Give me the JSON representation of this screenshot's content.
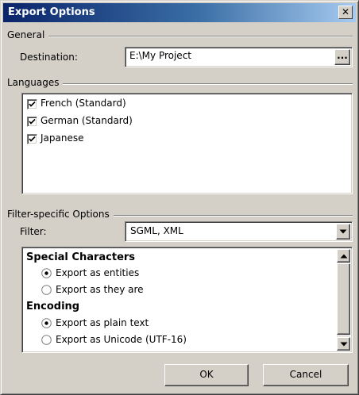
{
  "window": {
    "title": "Export Options",
    "close_glyph": "✕"
  },
  "general": {
    "group_label": "General",
    "destination_label": "Destination:",
    "destination_value": "E:\\My Project",
    "browse_label": "..."
  },
  "languages": {
    "group_label": "Languages",
    "items": [
      {
        "label": "French (Standard)",
        "checked": true
      },
      {
        "label": "German (Standard)",
        "checked": true
      },
      {
        "label": "Japanese",
        "checked": true
      }
    ]
  },
  "filter": {
    "group_label": "Filter-specific Options",
    "filter_label": "Filter:",
    "filter_value": "SGML, XML",
    "options_panel": {
      "special_characters": {
        "heading": "Special Characters",
        "options": [
          {
            "label": "Export as entities",
            "selected": true
          },
          {
            "label": "Export as they are",
            "selected": false
          }
        ]
      },
      "encoding": {
        "heading": "Encoding",
        "options": [
          {
            "label": "Export as plain text",
            "selected": true
          },
          {
            "label": "Export as Unicode (UTF-16)",
            "selected": false
          }
        ]
      }
    }
  },
  "buttons": {
    "ok_label": "OK",
    "cancel_label": "Cancel"
  },
  "icons": {
    "close": "close-icon",
    "checkmark": "checkmark-icon",
    "dropdown": "chevron-down-icon",
    "scroll_up": "scroll-up-arrow-icon",
    "scroll_down": "scroll-down-arrow-icon"
  },
  "colors": {
    "face": "#d4d0c8",
    "title_start": "#0a246a",
    "title_end": "#a6caf0",
    "window_bg": "#ffffff"
  }
}
